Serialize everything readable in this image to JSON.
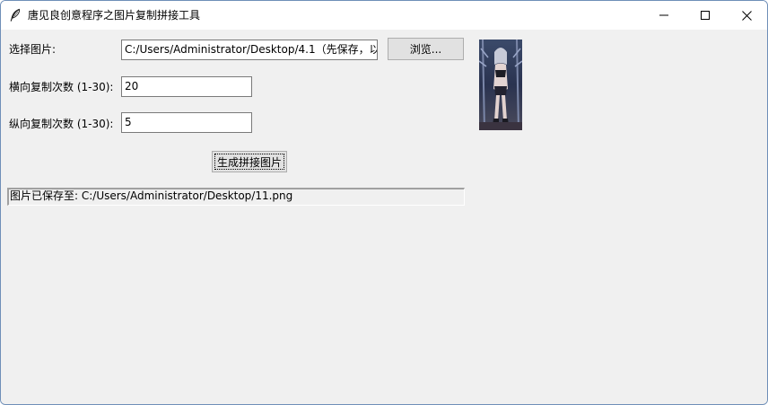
{
  "window": {
    "title": "唐见良创意程序之图片复制拼接工具",
    "icon": "feather-icon",
    "controls": [
      "minimize-icon",
      "maximize-icon",
      "close-icon"
    ]
  },
  "form": {
    "image_label": "选择图片:",
    "image_path": "C:/Users/Administrator/Desktop/4.1（先保存，以",
    "browse_label": "浏览...",
    "horizontal_label": "横向复制次数 (1-30):",
    "horizontal_value": "20",
    "vertical_label": "纵向复制次数 (1-30):",
    "vertical_value": "5",
    "generate_label": "生成拼接图片"
  },
  "status": {
    "text": "图片已保存至: C:/Users/Administrator/Desktop/11.png"
  },
  "preview": {
    "description_icon": "image-thumbnail"
  },
  "colors": {
    "window_bg": "#f0f0f0",
    "titlebar_bg": "#ffffff",
    "button_bg": "#e1e1e1",
    "border": "#7a7a7a"
  }
}
